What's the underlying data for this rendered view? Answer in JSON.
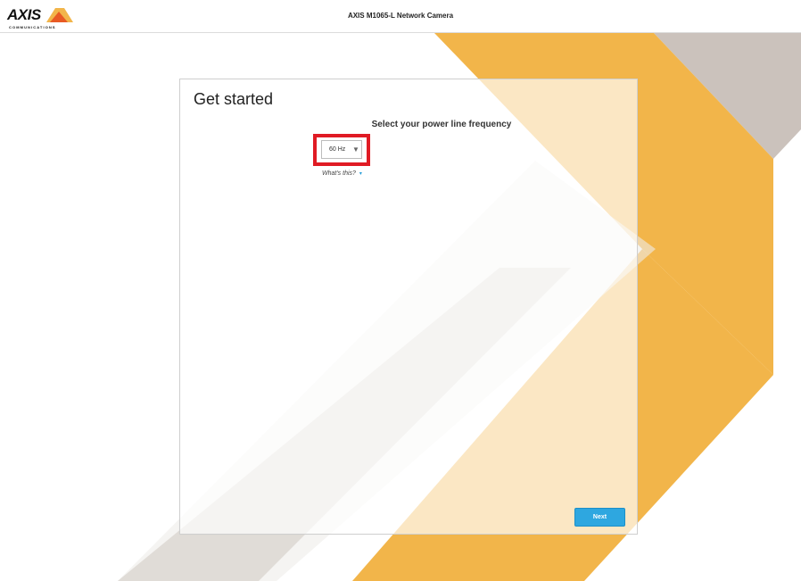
{
  "header": {
    "logo_text": "AXIS",
    "logo_subtext": "COMMUNICATIONS",
    "product_title": "AXIS M1065-L Network Camera"
  },
  "setup": {
    "title": "Get started",
    "frequency_label": "Select your power line frequency",
    "frequency_value": "60 Hz",
    "whats_this": "What's this?",
    "next_label": "Next"
  },
  "colors": {
    "accent_orange": "#f2b54a",
    "accent_taupe": "#cbc2bc",
    "button_blue": "#2ea7e0",
    "highlight_red": "#e01b24"
  },
  "icons": {
    "dropdown": "chevron-down-icon",
    "expand": "chevron-down-icon"
  }
}
